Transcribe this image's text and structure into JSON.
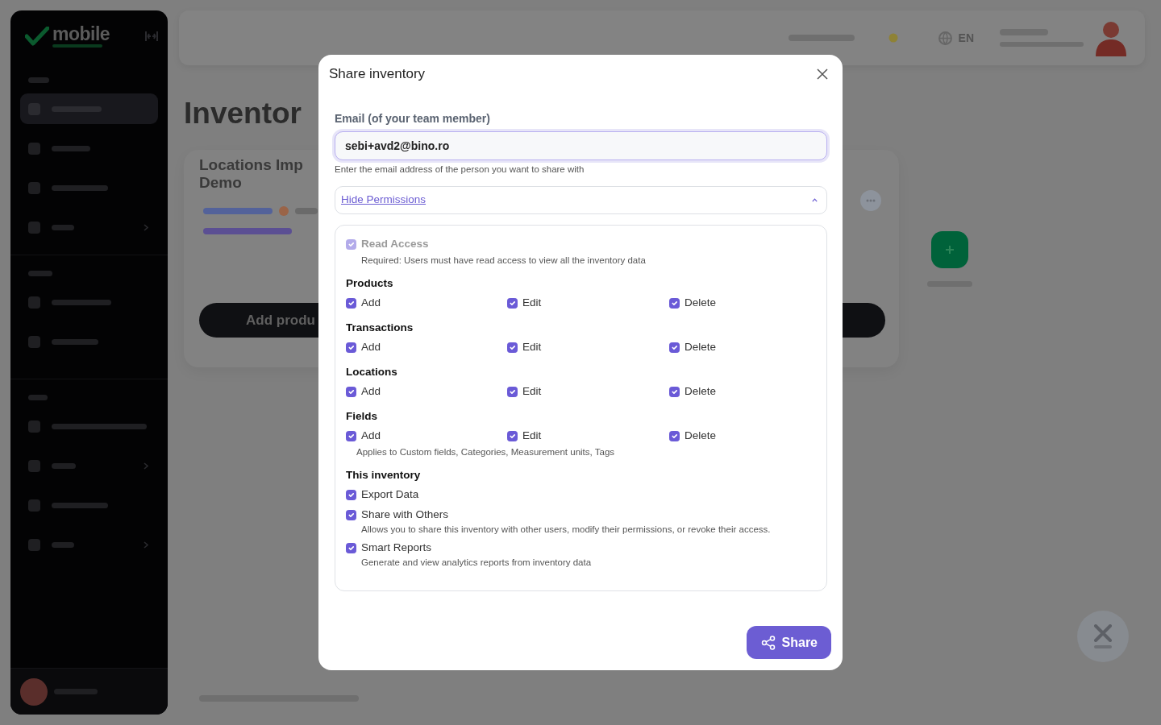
{
  "background": {
    "sidebar": {
      "logo": "mobile",
      "sections": [
        {
          "items": [
            {
              "selected": true,
              "submenu": false
            },
            {
              "selected": false,
              "submenu": false
            },
            {
              "selected": false,
              "submenu": false
            },
            {
              "selected": false,
              "submenu": true
            }
          ]
        },
        {
          "items": [
            {
              "selected": false,
              "submenu": false
            },
            {
              "selected": false,
              "submenu": false
            }
          ]
        },
        {
          "items": [
            {
              "selected": false,
              "submenu": false
            },
            {
              "selected": false,
              "submenu": true
            },
            {
              "selected": false,
              "submenu": false
            },
            {
              "selected": false,
              "submenu": true
            }
          ]
        }
      ]
    },
    "header": {
      "language": "EN"
    },
    "heading": "Inventor",
    "card": {
      "title": "Locations Imp Demo",
      "button": "Add produ"
    }
  },
  "modal": {
    "title": "Share inventory",
    "email": {
      "label": "Email (of your team member)",
      "value": "sebi+avd2@bino.ro",
      "focused": true,
      "help": "Enter the email address of the person you want to share with"
    },
    "permissions_toggle": {
      "label": "Hide Permissions",
      "expanded": true
    },
    "read_access": {
      "label": "Read Access",
      "checked": true,
      "disabled": true,
      "description": "Required: Users must have read access to view all the inventory data"
    },
    "groups": [
      {
        "title": "Products",
        "kind": "grid",
        "items": [
          {
            "label": "Add",
            "checked": true
          },
          {
            "label": "Edit",
            "checked": true
          },
          {
            "label": "Delete",
            "checked": true
          }
        ]
      },
      {
        "title": "Transactions",
        "kind": "grid",
        "items": [
          {
            "label": "Add",
            "checked": true
          },
          {
            "label": "Edit",
            "checked": true
          },
          {
            "label": "Delete",
            "checked": true
          }
        ]
      },
      {
        "title": "Locations",
        "kind": "grid",
        "items": [
          {
            "label": "Add",
            "checked": true
          },
          {
            "label": "Edit",
            "checked": true
          },
          {
            "label": "Delete",
            "checked": true
          }
        ]
      },
      {
        "title": "Fields",
        "kind": "grid",
        "items": [
          {
            "label": "Add",
            "checked": true
          },
          {
            "label": "Edit",
            "checked": true
          },
          {
            "label": "Delete",
            "checked": true
          }
        ],
        "note": "Applies to Custom fields, Categories, Measurement units, Tags"
      },
      {
        "title": "This inventory",
        "kind": "list",
        "items": [
          {
            "label": "Export Data",
            "checked": true
          },
          {
            "label": "Share with Others",
            "checked": true,
            "description": "Allows you to share this inventory with other users, modify their permissions, or revoke their access."
          },
          {
            "label": "Smart Reports",
            "checked": true,
            "description": "Generate and view analytics reports from inventory data"
          }
        ]
      }
    ],
    "share_button": "Share"
  }
}
